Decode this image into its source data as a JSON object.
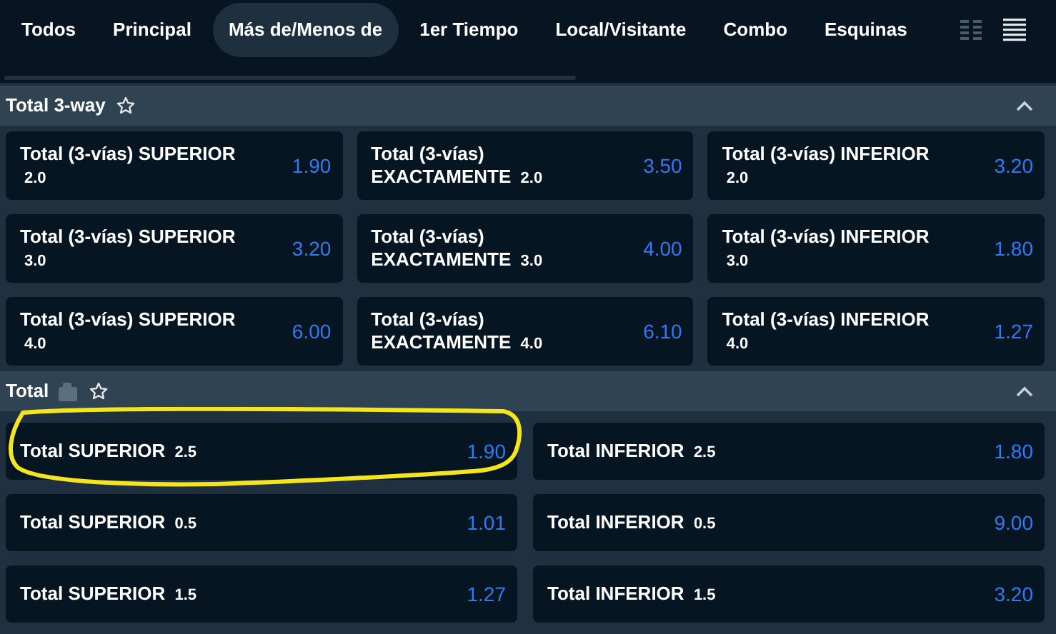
{
  "tabs": [
    {
      "label": "Todos",
      "selected": false
    },
    {
      "label": "Principal",
      "selected": false
    },
    {
      "label": "Más de/Menos de",
      "selected": true
    },
    {
      "label": "1er Tiempo",
      "selected": false
    },
    {
      "label": "Local/Visitante",
      "selected": false
    },
    {
      "label": "Combo",
      "selected": false
    },
    {
      "label": "Esquinas",
      "selected": false
    }
  ],
  "markets": [
    {
      "title": "Total 3-way",
      "expanded": true,
      "kind": "three_way",
      "outcomes": [
        {
          "label": "Total (3-vías) SUPERIOR",
          "line": "2.0",
          "odds": "1.90"
        },
        {
          "label": "Total (3-vías) EXACTAMENTE",
          "line": "2.0",
          "odds": "3.50"
        },
        {
          "label": "Total (3-vías) INFERIOR",
          "line": "2.0",
          "odds": "3.20"
        },
        {
          "label": "Total (3-vías) SUPERIOR",
          "line": "3.0",
          "odds": "3.20"
        },
        {
          "label": "Total (3-vías) EXACTAMENTE",
          "line": "3.0",
          "odds": "4.00"
        },
        {
          "label": "Total (3-vías) INFERIOR",
          "line": "3.0",
          "odds": "1.80"
        },
        {
          "label": "Total (3-vías) SUPERIOR",
          "line": "4.0",
          "odds": "6.00"
        },
        {
          "label": "Total (3-vías) EXACTAMENTE",
          "line": "4.0",
          "odds": "6.10"
        },
        {
          "label": "Total (3-vías) INFERIOR",
          "line": "4.0",
          "odds": "1.27"
        }
      ]
    },
    {
      "title": "Total",
      "expanded": true,
      "kind": "two_way",
      "builder": true,
      "outcomes": [
        {
          "label": "Total SUPERIOR",
          "line": "2.5",
          "odds": "1.90",
          "highlighted": true
        },
        {
          "label": "Total INFERIOR",
          "line": "2.5",
          "odds": "1.80",
          "highlighted": false
        },
        {
          "label": "Total SUPERIOR",
          "line": "0.5",
          "odds": "1.01",
          "highlighted": false
        },
        {
          "label": "Total INFERIOR",
          "line": "0.5",
          "odds": "9.00",
          "highlighted": false
        },
        {
          "label": "Total SUPERIOR",
          "line": "1.5",
          "odds": "1.27",
          "highlighted": false
        },
        {
          "label": "Total INFERIOR",
          "line": "1.5",
          "odds": "3.20",
          "highlighted": false
        }
      ]
    }
  ]
}
